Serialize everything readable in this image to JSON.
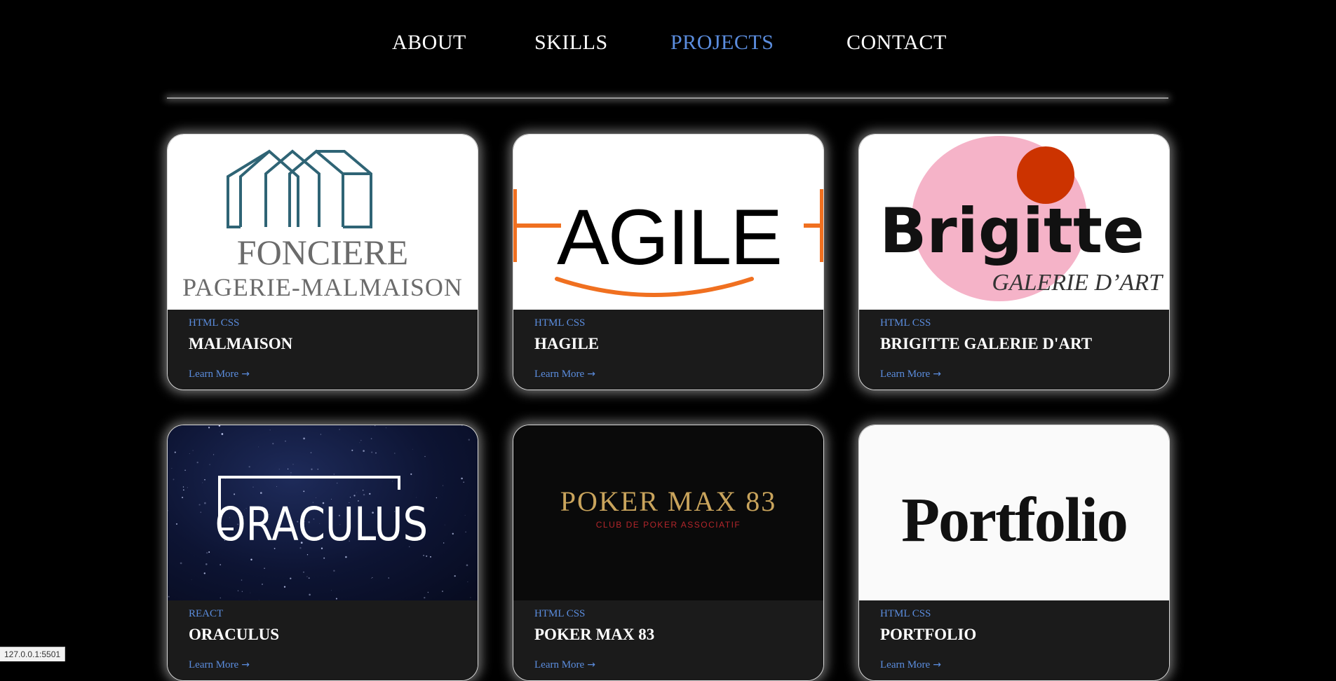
{
  "nav": {
    "items": [
      {
        "label": "ABOUT",
        "active": false
      },
      {
        "label": "SKILLS",
        "active": false
      },
      {
        "label": "PROJECTS",
        "active": true
      },
      {
        "label": "CONTACT",
        "active": false
      }
    ]
  },
  "projects": [
    {
      "tags": "HTML CSS",
      "title": "MALMAISON",
      "learn_more": "Learn More",
      "image": {
        "icon": "house-outline-logo",
        "line1": "FONCIERE",
        "line2": "PAGERIE-MALMAISON"
      }
    },
    {
      "tags": "HTML CSS",
      "title": "HAGILE",
      "learn_more": "Learn More",
      "image": {
        "wordmark": "AGILE"
      }
    },
    {
      "tags": "HTML CSS",
      "title": "BRIGITTE GALERIE D'ART",
      "learn_more": "Learn More",
      "image": {
        "wordmark": "Brigitte",
        "subtitle": "GALERIE D’ART"
      }
    },
    {
      "tags": "REACT",
      "title": "ORACULUS",
      "learn_more": "Learn More",
      "image": {
        "wordmark": "ORACULUS",
        "background": "starfield"
      }
    },
    {
      "tags": "HTML CSS",
      "title": "POKER MAX 83",
      "learn_more": "Learn More",
      "image": {
        "wordmark": "POKER MAX 83",
        "subtitle": "CLUB DE POKER ASSOCIATIF"
      }
    },
    {
      "tags": "HTML CSS",
      "title": "PORTFOLIO",
      "learn_more": "Learn More",
      "image": {
        "wordmark": "Portfolio"
      }
    }
  ],
  "status_bar": {
    "url": "127.0.0.1:5501"
  },
  "colors": {
    "accent": "#5b8dde",
    "background": "#000000",
    "card_body": "#1b1b1b"
  }
}
